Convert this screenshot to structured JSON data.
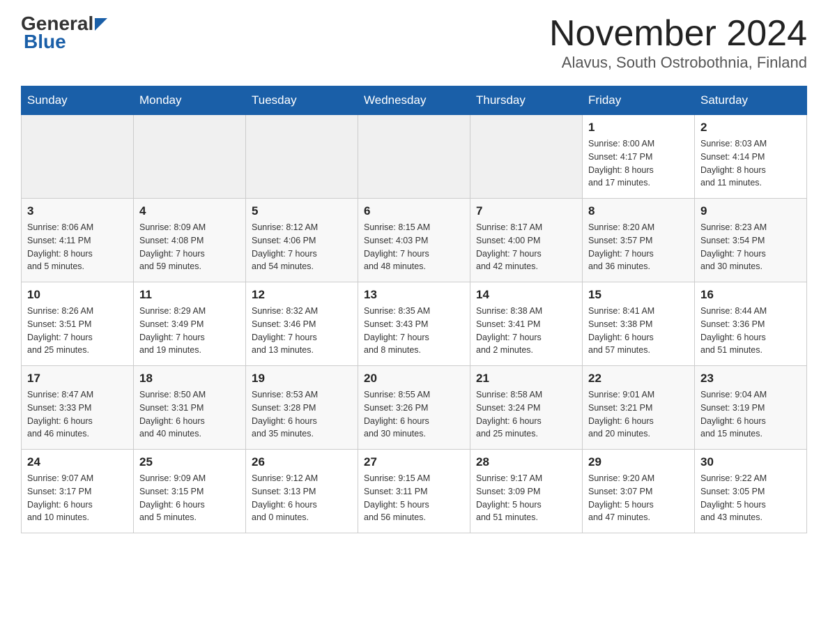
{
  "header": {
    "logo": {
      "general": "General",
      "blue": "Blue"
    },
    "title": "November 2024",
    "location": "Alavus, South Ostrobothnia, Finland"
  },
  "calendar": {
    "weekdays": [
      "Sunday",
      "Monday",
      "Tuesday",
      "Wednesday",
      "Thursday",
      "Friday",
      "Saturday"
    ],
    "weeks": [
      [
        {
          "day": "",
          "info": ""
        },
        {
          "day": "",
          "info": ""
        },
        {
          "day": "",
          "info": ""
        },
        {
          "day": "",
          "info": ""
        },
        {
          "day": "",
          "info": ""
        },
        {
          "day": "1",
          "info": "Sunrise: 8:00 AM\nSunset: 4:17 PM\nDaylight: 8 hours\nand 17 minutes."
        },
        {
          "day": "2",
          "info": "Sunrise: 8:03 AM\nSunset: 4:14 PM\nDaylight: 8 hours\nand 11 minutes."
        }
      ],
      [
        {
          "day": "3",
          "info": "Sunrise: 8:06 AM\nSunset: 4:11 PM\nDaylight: 8 hours\nand 5 minutes."
        },
        {
          "day": "4",
          "info": "Sunrise: 8:09 AM\nSunset: 4:08 PM\nDaylight: 7 hours\nand 59 minutes."
        },
        {
          "day": "5",
          "info": "Sunrise: 8:12 AM\nSunset: 4:06 PM\nDaylight: 7 hours\nand 54 minutes."
        },
        {
          "day": "6",
          "info": "Sunrise: 8:15 AM\nSunset: 4:03 PM\nDaylight: 7 hours\nand 48 minutes."
        },
        {
          "day": "7",
          "info": "Sunrise: 8:17 AM\nSunset: 4:00 PM\nDaylight: 7 hours\nand 42 minutes."
        },
        {
          "day": "8",
          "info": "Sunrise: 8:20 AM\nSunset: 3:57 PM\nDaylight: 7 hours\nand 36 minutes."
        },
        {
          "day": "9",
          "info": "Sunrise: 8:23 AM\nSunset: 3:54 PM\nDaylight: 7 hours\nand 30 minutes."
        }
      ],
      [
        {
          "day": "10",
          "info": "Sunrise: 8:26 AM\nSunset: 3:51 PM\nDaylight: 7 hours\nand 25 minutes."
        },
        {
          "day": "11",
          "info": "Sunrise: 8:29 AM\nSunset: 3:49 PM\nDaylight: 7 hours\nand 19 minutes."
        },
        {
          "day": "12",
          "info": "Sunrise: 8:32 AM\nSunset: 3:46 PM\nDaylight: 7 hours\nand 13 minutes."
        },
        {
          "day": "13",
          "info": "Sunrise: 8:35 AM\nSunset: 3:43 PM\nDaylight: 7 hours\nand 8 minutes."
        },
        {
          "day": "14",
          "info": "Sunrise: 8:38 AM\nSunset: 3:41 PM\nDaylight: 7 hours\nand 2 minutes."
        },
        {
          "day": "15",
          "info": "Sunrise: 8:41 AM\nSunset: 3:38 PM\nDaylight: 6 hours\nand 57 minutes."
        },
        {
          "day": "16",
          "info": "Sunrise: 8:44 AM\nSunset: 3:36 PM\nDaylight: 6 hours\nand 51 minutes."
        }
      ],
      [
        {
          "day": "17",
          "info": "Sunrise: 8:47 AM\nSunset: 3:33 PM\nDaylight: 6 hours\nand 46 minutes."
        },
        {
          "day": "18",
          "info": "Sunrise: 8:50 AM\nSunset: 3:31 PM\nDaylight: 6 hours\nand 40 minutes."
        },
        {
          "day": "19",
          "info": "Sunrise: 8:53 AM\nSunset: 3:28 PM\nDaylight: 6 hours\nand 35 minutes."
        },
        {
          "day": "20",
          "info": "Sunrise: 8:55 AM\nSunset: 3:26 PM\nDaylight: 6 hours\nand 30 minutes."
        },
        {
          "day": "21",
          "info": "Sunrise: 8:58 AM\nSunset: 3:24 PM\nDaylight: 6 hours\nand 25 minutes."
        },
        {
          "day": "22",
          "info": "Sunrise: 9:01 AM\nSunset: 3:21 PM\nDaylight: 6 hours\nand 20 minutes."
        },
        {
          "day": "23",
          "info": "Sunrise: 9:04 AM\nSunset: 3:19 PM\nDaylight: 6 hours\nand 15 minutes."
        }
      ],
      [
        {
          "day": "24",
          "info": "Sunrise: 9:07 AM\nSunset: 3:17 PM\nDaylight: 6 hours\nand 10 minutes."
        },
        {
          "day": "25",
          "info": "Sunrise: 9:09 AM\nSunset: 3:15 PM\nDaylight: 6 hours\nand 5 minutes."
        },
        {
          "day": "26",
          "info": "Sunrise: 9:12 AM\nSunset: 3:13 PM\nDaylight: 6 hours\nand 0 minutes."
        },
        {
          "day": "27",
          "info": "Sunrise: 9:15 AM\nSunset: 3:11 PM\nDaylight: 5 hours\nand 56 minutes."
        },
        {
          "day": "28",
          "info": "Sunrise: 9:17 AM\nSunset: 3:09 PM\nDaylight: 5 hours\nand 51 minutes."
        },
        {
          "day": "29",
          "info": "Sunrise: 9:20 AM\nSunset: 3:07 PM\nDaylight: 5 hours\nand 47 minutes."
        },
        {
          "day": "30",
          "info": "Sunrise: 9:22 AM\nSunset: 3:05 PM\nDaylight: 5 hours\nand 43 minutes."
        }
      ]
    ]
  }
}
